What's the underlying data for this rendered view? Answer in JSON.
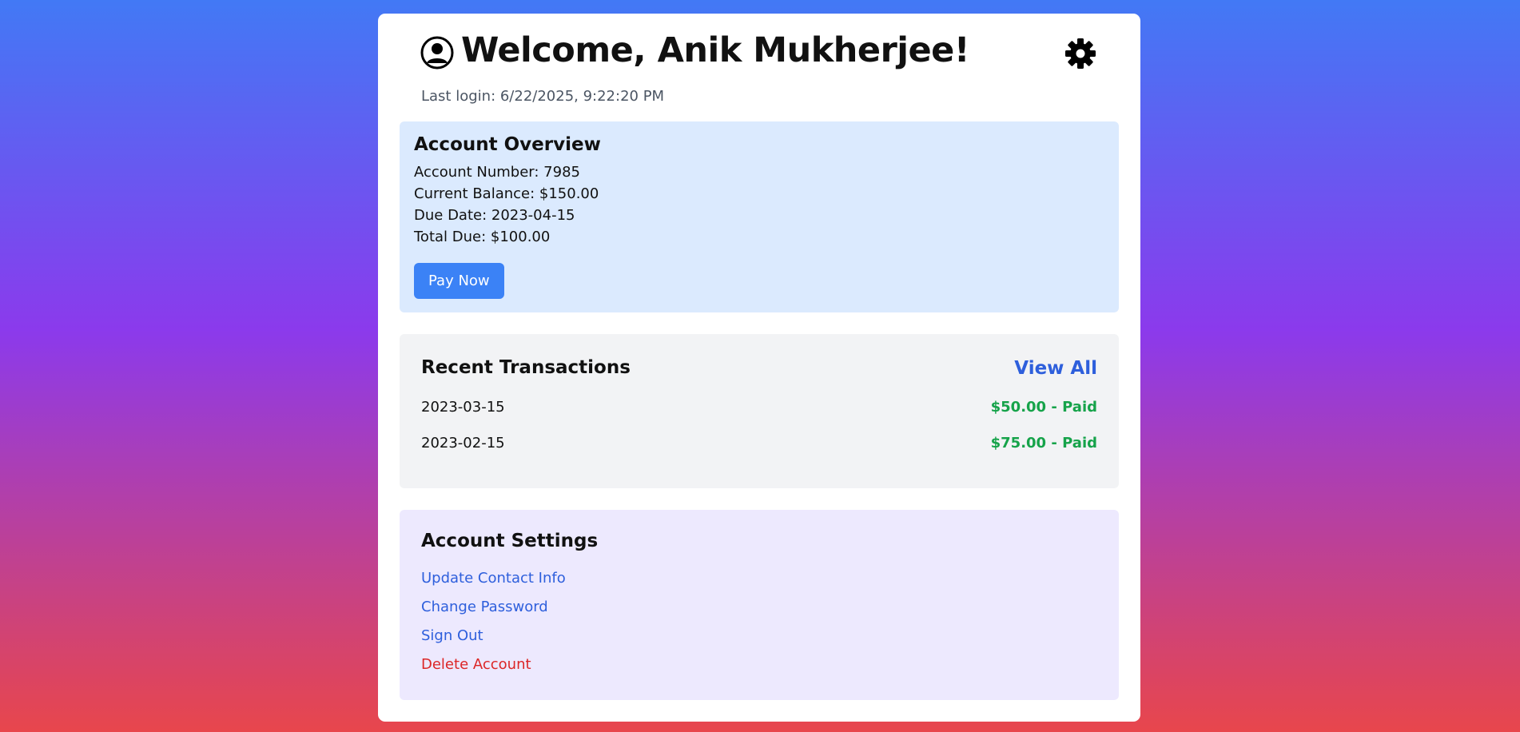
{
  "header": {
    "user_icon": "user-circle-icon",
    "title": "Welcome, Anik Mukherjee!",
    "settings_icon": "gear-icon",
    "last_login": "Last login: 6/22/2025, 9:22:20 PM"
  },
  "overview": {
    "title": "Account Overview",
    "account_number": "Account Number: 7985",
    "current_balance": "Current Balance: $150.00",
    "due_date": "Due Date: 2023-04-15",
    "total_due": "Total Due: $100.00",
    "pay_button": "Pay Now"
  },
  "transactions": {
    "title": "Recent Transactions",
    "view_all": "View All",
    "items": [
      {
        "date": "2023-03-15",
        "amount": "$50.00 - Paid"
      },
      {
        "date": "2023-02-15",
        "amount": "$75.00 - Paid"
      }
    ]
  },
  "settings": {
    "title": "Account Settings",
    "links": [
      {
        "label": "Update Contact Info"
      },
      {
        "label": "Change Password"
      },
      {
        "label": "Sign Out"
      },
      {
        "label": "Delete Account"
      }
    ]
  },
  "colors": {
    "accent": "#3b82f6",
    "link": "#2e5fdc",
    "paid": "#16a34a",
    "danger": "#dc2626",
    "overview_bg": "#dbeafe",
    "transactions_bg": "#f2f3f5",
    "settings_bg": "#ede9fe"
  }
}
